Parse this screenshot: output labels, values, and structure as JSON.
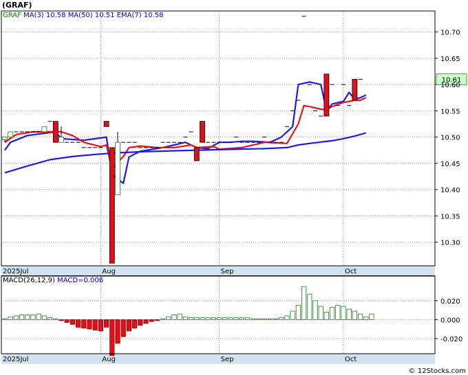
{
  "chart_data": {
    "type": "candlestick",
    "symbol": "(GRAF)",
    "indicator_legend": [
      {
        "text": "GRAF",
        "color": "#008000"
      },
      {
        "text": "MA(3)",
        "color": "#0000cc"
      },
      {
        "text": "10.58",
        "color": "#0000cc"
      },
      {
        "text": "MA(50)",
        "color": "#0000cc"
      },
      {
        "text": "10.51",
        "color": "#0000cc"
      },
      {
        "text": "EMA(7)",
        "color": "#0000cc"
      },
      {
        "text": "10.58",
        "color": "#0000cc"
      }
    ],
    "price_axis": {
      "ylim": [
        10.255,
        10.74
      ],
      "ticks": [
        "10.70",
        "10.65",
        "10.60",
        "10.55",
        "10.50",
        "10.45",
        "10.40",
        "10.35",
        "10.30"
      ]
    },
    "last_price": "10.61",
    "x_labels": [
      {
        "label": "2025Jul",
        "i": 0
      },
      {
        "label": "Aug",
        "i": 17
      },
      {
        "label": "Sep",
        "i": 38
      },
      {
        "label": "Oct",
        "i": 60
      }
    ],
    "candles": [
      [
        10.495,
        10.5,
        10.49,
        10.5
      ],
      [
        10.5,
        10.51,
        10.5,
        10.51
      ],
      [
        10.51,
        10.51,
        10.51,
        10.51
      ],
      [
        10.51,
        10.51,
        10.51,
        10.51
      ],
      [
        10.51,
        10.51,
        10.51,
        10.51
      ],
      [
        10.51,
        10.51,
        10.51,
        10.51
      ],
      [
        10.51,
        10.51,
        10.51,
        10.51
      ],
      [
        10.51,
        10.52,
        10.51,
        10.52
      ],
      [
        10.53,
        10.53,
        10.53,
        10.53
      ],
      [
        10.53,
        10.53,
        10.49,
        10.49
      ],
      [
        10.49,
        10.52,
        10.49,
        10.5
      ],
      [
        10.49,
        10.49,
        10.49,
        10.49
      ],
      [
        10.49,
        10.49,
        10.49,
        10.49
      ],
      [
        10.49,
        10.49,
        10.49,
        10.49
      ],
      [
        10.48,
        10.48,
        10.48,
        10.48
      ],
      [
        10.48,
        10.48,
        10.48,
        10.48
      ],
      [
        10.48,
        10.48,
        10.48,
        10.48
      ],
      [
        10.48,
        10.48,
        10.48,
        10.48
      ],
      [
        10.53,
        10.53,
        10.52,
        10.52
      ],
      [
        10.48,
        10.48,
        10.26,
        10.26
      ],
      [
        10.39,
        10.51,
        10.39,
        10.49
      ],
      [
        10.49,
        10.49,
        10.49,
        10.49
      ],
      [
        10.49,
        10.49,
        10.49,
        10.49
      ],
      [
        10.49,
        10.49,
        10.49,
        10.49
      ],
      [
        10.48,
        10.48,
        10.48,
        10.48
      ],
      [
        10.48,
        10.48,
        10.48,
        10.48
      ],
      [
        10.48,
        10.48,
        10.48,
        10.48
      ],
      [
        10.48,
        10.48,
        10.48,
        10.48
      ],
      [
        10.49,
        10.49,
        10.49,
        10.49
      ],
      [
        10.49,
        10.49,
        10.49,
        10.49
      ],
      [
        10.49,
        10.49,
        10.49,
        10.49
      ],
      [
        10.49,
        10.49,
        10.49,
        10.49
      ],
      [
        10.5,
        10.5,
        10.5,
        10.5
      ],
      [
        10.51,
        10.51,
        10.51,
        10.51
      ],
      [
        10.48,
        10.48,
        10.455,
        10.455
      ],
      [
        10.53,
        10.53,
        10.49,
        10.49
      ],
      [
        10.49,
        10.49,
        10.49,
        10.49
      ],
      [
        10.49,
        10.49,
        10.49,
        10.49
      ],
      [
        10.49,
        10.49,
        10.49,
        10.49
      ],
      [
        10.49,
        10.49,
        10.49,
        10.49
      ],
      [
        10.49,
        10.49,
        10.49,
        10.49
      ],
      [
        10.5,
        10.5,
        10.5,
        10.5
      ],
      [
        10.49,
        10.49,
        10.49,
        10.49
      ],
      [
        10.49,
        10.49,
        10.49,
        10.49
      ],
      [
        10.49,
        10.49,
        10.49,
        10.49
      ],
      [
        10.49,
        10.49,
        10.49,
        10.49
      ],
      [
        10.5,
        10.5,
        10.5,
        10.5
      ],
      [
        10.49,
        10.49,
        10.49,
        10.49
      ],
      [
        10.49,
        10.49,
        10.49,
        10.49
      ],
      [
        10.49,
        10.49,
        10.49,
        10.49
      ],
      [
        10.52,
        10.52,
        10.52,
        10.52
      ],
      [
        10.55,
        10.55,
        10.55,
        10.55
      ],
      [
        10.57,
        10.57,
        10.57,
        10.57
      ],
      [
        10.73,
        10.73,
        10.73,
        10.73
      ],
      [
        10.6,
        10.6,
        10.6,
        10.6
      ],
      [
        10.55,
        10.55,
        10.55,
        10.55
      ],
      [
        10.54,
        10.54,
        10.54,
        10.54
      ],
      [
        10.62,
        10.62,
        10.54,
        10.54
      ],
      [
        10.6,
        10.6,
        10.6,
        10.6
      ],
      [
        10.56,
        10.56,
        10.56,
        10.56
      ],
      [
        10.6,
        10.6,
        10.6,
        10.6
      ],
      [
        10.56,
        10.56,
        10.56,
        10.56
      ],
      [
        10.61,
        10.61,
        10.57,
        10.57
      ],
      [
        10.61,
        10.61,
        10.61,
        10.61
      ]
    ],
    "series": [
      {
        "name": "MA(3)",
        "color": "#1a1aee",
        "points": [
          [
            0,
            10.475
          ],
          [
            1,
            10.49
          ],
          [
            4,
            10.503
          ],
          [
            9,
            10.51
          ],
          [
            10,
            10.497
          ],
          [
            14,
            10.494
          ],
          [
            18,
            10.5
          ],
          [
            19,
            10.43
          ],
          [
            20,
            10.42
          ],
          [
            21,
            10.412
          ],
          [
            22,
            10.462
          ],
          [
            24,
            10.473
          ],
          [
            28,
            10.48
          ],
          [
            30,
            10.485
          ],
          [
            32,
            10.49
          ],
          [
            34,
            10.48
          ],
          [
            36,
            10.478
          ],
          [
            38,
            10.49
          ],
          [
            40,
            10.49
          ],
          [
            42,
            10.492
          ],
          [
            44,
            10.492
          ],
          [
            47,
            10.49
          ],
          [
            49,
            10.5
          ],
          [
            51,
            10.52
          ],
          [
            52,
            10.6
          ],
          [
            54,
            10.605
          ],
          [
            56,
            10.6
          ],
          [
            57,
            10.55
          ],
          [
            58,
            10.563
          ],
          [
            60,
            10.568
          ],
          [
            61,
            10.585
          ],
          [
            62,
            10.572
          ],
          [
            63,
            10.575
          ],
          [
            64,
            10.58
          ]
        ]
      },
      {
        "name": "EMA(7)",
        "color": "#ee1111",
        "points": [
          [
            0,
            10.49
          ],
          [
            2,
            10.505
          ],
          [
            5,
            10.51
          ],
          [
            8,
            10.51
          ],
          [
            10,
            10.51
          ],
          [
            12,
            10.503
          ],
          [
            14,
            10.49
          ],
          [
            17,
            10.482
          ],
          [
            18,
            10.485
          ],
          [
            19,
            10.438
          ],
          [
            20,
            10.452
          ],
          [
            21,
            10.463
          ],
          [
            22,
            10.48
          ],
          [
            24,
            10.483
          ],
          [
            27,
            10.48
          ],
          [
            30,
            10.48
          ],
          [
            33,
            10.485
          ],
          [
            34,
            10.48
          ],
          [
            37,
            10.482
          ],
          [
            38,
            10.477
          ],
          [
            42,
            10.48
          ],
          [
            46,
            10.49
          ],
          [
            50,
            10.488
          ],
          [
            52,
            10.525
          ],
          [
            53,
            10.56
          ],
          [
            54,
            10.558
          ],
          [
            56,
            10.553
          ],
          [
            57,
            10.552
          ],
          [
            58,
            10.558
          ],
          [
            60,
            10.566
          ],
          [
            62,
            10.57
          ],
          [
            63,
            10.57
          ],
          [
            64,
            10.575
          ]
        ]
      },
      {
        "name": "MA(50)",
        "color": "#1a1aee",
        "points": [
          [
            0,
            10.432
          ],
          [
            4,
            10.445
          ],
          [
            8,
            10.457
          ],
          [
            12,
            10.463
          ],
          [
            16,
            10.467
          ],
          [
            20,
            10.47
          ],
          [
            24,
            10.472
          ],
          [
            30,
            10.474
          ],
          [
            38,
            10.476
          ],
          [
            46,
            10.478
          ],
          [
            50,
            10.48
          ],
          [
            52,
            10.485
          ],
          [
            54,
            10.488
          ],
          [
            58,
            10.493
          ],
          [
            60,
            10.497
          ],
          [
            62,
            10.502
          ],
          [
            64,
            10.508
          ]
        ]
      }
    ],
    "macd": {
      "label": "MACD(26,12,9)",
      "value_label": "MACD=0.006",
      "ylim": [
        -0.036,
        0.046
      ],
      "ticks": [
        "0.020",
        "0.000",
        "-0.020"
      ],
      "values": [
        0.001,
        0.003,
        0.004,
        0.005,
        0.005,
        0.005,
        0.006,
        0.004,
        0.002,
        0.001,
        -0.001,
        -0.003,
        -0.005,
        -0.008,
        -0.009,
        -0.01,
        -0.011,
        -0.012,
        -0.008,
        -0.038,
        -0.025,
        -0.018,
        -0.012,
        -0.009,
        -0.006,
        -0.004,
        -0.002,
        -0.001,
        0.001,
        0.003,
        0.005,
        0.006,
        0.003,
        0.002,
        0.002,
        0.002,
        0.002,
        0.002,
        0.002,
        0.002,
        0.002,
        0.002,
        0.002,
        0.002,
        0.001,
        0.001,
        0.001,
        0.001,
        0.001,
        0.002,
        0.004,
        0.009,
        0.015,
        0.035,
        0.027,
        0.02,
        0.014,
        0.008,
        0.013,
        0.015,
        0.014,
        0.011,
        0.009,
        0.006,
        0.003,
        0.006
      ]
    },
    "watermark": "© 12Stocks.com"
  }
}
